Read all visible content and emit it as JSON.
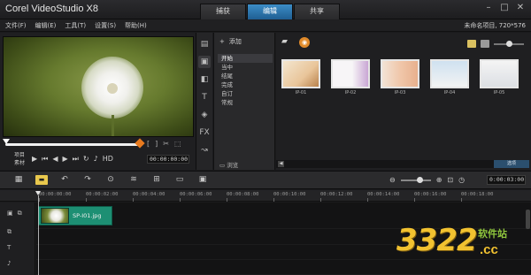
{
  "window": {
    "title": "Corel VideoStudio X8",
    "tabs": [
      {
        "label": "捕获",
        "active": false
      },
      {
        "label": "编辑",
        "active": true
      },
      {
        "label": "共享",
        "active": false
      }
    ],
    "controls": [
      "minimize",
      "maximize",
      "close"
    ]
  },
  "menu": {
    "items": [
      "文件(F)",
      "编辑(E)",
      "工具(T)",
      "设置(S)",
      "帮助(H)"
    ],
    "project_info": "未命名项目, 720*576"
  },
  "player": {
    "mode_labels": [
      "项目",
      "素材"
    ],
    "timecode": "00:00:00:00",
    "hd_label": "HD",
    "trim_marks": [
      "[",
      "]"
    ]
  },
  "library": {
    "add_label": "添加",
    "categories": [
      "开始",
      "当中",
      "结尾",
      "完成",
      "自订",
      "常规"
    ],
    "active_category": "开始",
    "browse_label": "浏览",
    "thumbnails": [
      {
        "caption": "IP-01"
      },
      {
        "caption": "IP-02"
      },
      {
        "caption": "IP-03"
      },
      {
        "caption": "IP-04"
      },
      {
        "caption": "IP-05"
      }
    ],
    "options_label": "选项"
  },
  "timeline": {
    "ruler_labels": [
      "00:00:00:00",
      "00:00:02:00",
      "00:00:04:00",
      "00:00:06:00",
      "00:00:08:00",
      "00:00:10:00",
      "00:00:12:00",
      "00:00:14:00",
      "00:00:16:00",
      "00:00:18:00"
    ],
    "timecode": "0:00:03:00",
    "clip_label": "SP-I01.jpg"
  },
  "watermark": {
    "number": "3322",
    "site": "软件站",
    "domain": ".cc"
  },
  "colors": {
    "accent_tab": "#2f7ab5",
    "clip": "#1d8f73",
    "scrub_end": "#e87a1e",
    "watermark_gold": "#f2c230",
    "watermark_green": "#8fc63d"
  }
}
